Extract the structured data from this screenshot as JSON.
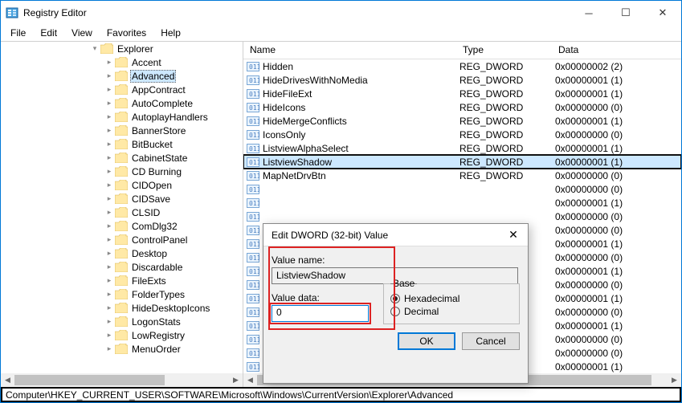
{
  "window": {
    "title": "Registry Editor"
  },
  "menu": {
    "file": "File",
    "edit": "Edit",
    "view": "View",
    "favorites": "Favorites",
    "help": "Help"
  },
  "tree": {
    "root": "Explorer",
    "items": [
      "Accent",
      "Advanced",
      "AppContract",
      "AutoComplete",
      "AutoplayHandlers",
      "BannerStore",
      "BitBucket",
      "CabinetState",
      "CD Burning",
      "CIDOpen",
      "CIDSave",
      "CLSID",
      "ComDlg32",
      "ControlPanel",
      "Desktop",
      "Discardable",
      "FileExts",
      "FolderTypes",
      "HideDesktopIcons",
      "LogonStats",
      "LowRegistry",
      "MenuOrder"
    ],
    "selected_index": 1
  },
  "list": {
    "headers": {
      "name": "Name",
      "type": "Type",
      "data": "Data"
    },
    "rows": [
      {
        "name": "Hidden",
        "type": "REG_DWORD",
        "data": "0x00000002 (2)"
      },
      {
        "name": "HideDrivesWithNoMedia",
        "type": "REG_DWORD",
        "data": "0x00000001 (1)"
      },
      {
        "name": "HideFileExt",
        "type": "REG_DWORD",
        "data": "0x00000001 (1)"
      },
      {
        "name": "HideIcons",
        "type": "REG_DWORD",
        "data": "0x00000000 (0)"
      },
      {
        "name": "HideMergeConflicts",
        "type": "REG_DWORD",
        "data": "0x00000001 (1)"
      },
      {
        "name": "IconsOnly",
        "type": "REG_DWORD",
        "data": "0x00000000 (0)"
      },
      {
        "name": "ListviewAlphaSelect",
        "type": "REG_DWORD",
        "data": "0x00000001 (1)"
      },
      {
        "name": "ListviewShadow",
        "type": "REG_DWORD",
        "data": "0x00000001 (1)"
      },
      {
        "name": "MapNetDrvBtn",
        "type": "REG_DWORD",
        "data": "0x00000000 (0)"
      },
      {
        "name": "",
        "type": "",
        "data": "0x00000000 (0)"
      },
      {
        "name": "",
        "type": "",
        "data": "0x00000001 (1)"
      },
      {
        "name": "",
        "type": "",
        "data": "0x00000000 (0)"
      },
      {
        "name": "",
        "type": "",
        "data": "0x00000000 (0)"
      },
      {
        "name": "",
        "type": "",
        "data": "0x00000001 (1)"
      },
      {
        "name": "",
        "type": "",
        "data": "0x00000000 (0)"
      },
      {
        "name": "",
        "type": "",
        "data": "0x00000001 (1)"
      },
      {
        "name": "",
        "type": "",
        "data": "0x00000000 (0)"
      },
      {
        "name": "",
        "type": "",
        "data": "0x00000001 (1)"
      },
      {
        "name": "",
        "type": "",
        "data": "0x00000000 (0)"
      },
      {
        "name": "",
        "type": "",
        "data": "0x00000001 (1)"
      },
      {
        "name": "",
        "type": "",
        "data": "0x00000000 (0)"
      },
      {
        "name": "",
        "type": "",
        "data": "0x00000000 (0)"
      },
      {
        "name": "",
        "type": "",
        "data": "0x00000001 (1)"
      }
    ],
    "selected_index": 7
  },
  "dialog": {
    "title": "Edit DWORD (32-bit) Value",
    "value_name_label": "Value name:",
    "value_name": "ListviewShadow",
    "value_data_label": "Value data:",
    "value_data": "0",
    "base_label": "Base",
    "hex_label": "Hexadecimal",
    "dec_label": "Decimal",
    "base_selected": "hex",
    "ok": "OK",
    "cancel": "Cancel"
  },
  "statusbar": "Computer\\HKEY_CURRENT_USER\\SOFTWARE\\Microsoft\\Windows\\CurrentVersion\\Explorer\\Advanced"
}
